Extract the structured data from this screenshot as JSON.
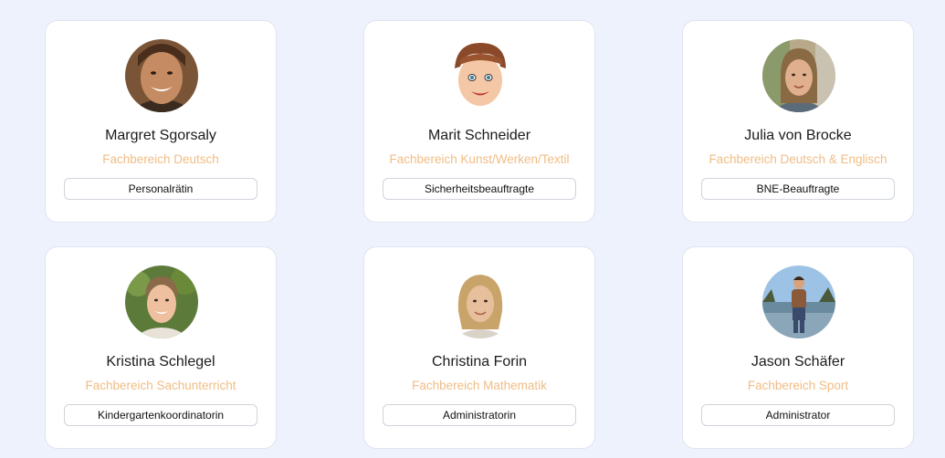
{
  "staff": [
    {
      "name": "Margret Sgorsaly",
      "department": "Fachbereich Deutsch",
      "role": "Personalrätin"
    },
    {
      "name": "Marit Schneider",
      "department": "Fachbereich Kunst/Werken/Textil",
      "role": "Sicherheitsbeauftragte"
    },
    {
      "name": "Julia von Brocke",
      "department": "Fachbereich Deutsch & Englisch",
      "role": "BNE-Beauftragte"
    },
    {
      "name": "Kristina Schlegel",
      "department": "Fachbereich Sachunterricht",
      "role": "Kindergartenkoordinatorin"
    },
    {
      "name": "Christina Forin",
      "department": "Fachbereich Mathematik",
      "role": "Administratorin"
    },
    {
      "name": "Jason Schäfer",
      "department": "Fachbereich Sport",
      "role": "Administrator"
    }
  ],
  "colors": {
    "page_background": "#eef2fd",
    "card_background": "#ffffff",
    "department_text": "#f0bd85"
  }
}
